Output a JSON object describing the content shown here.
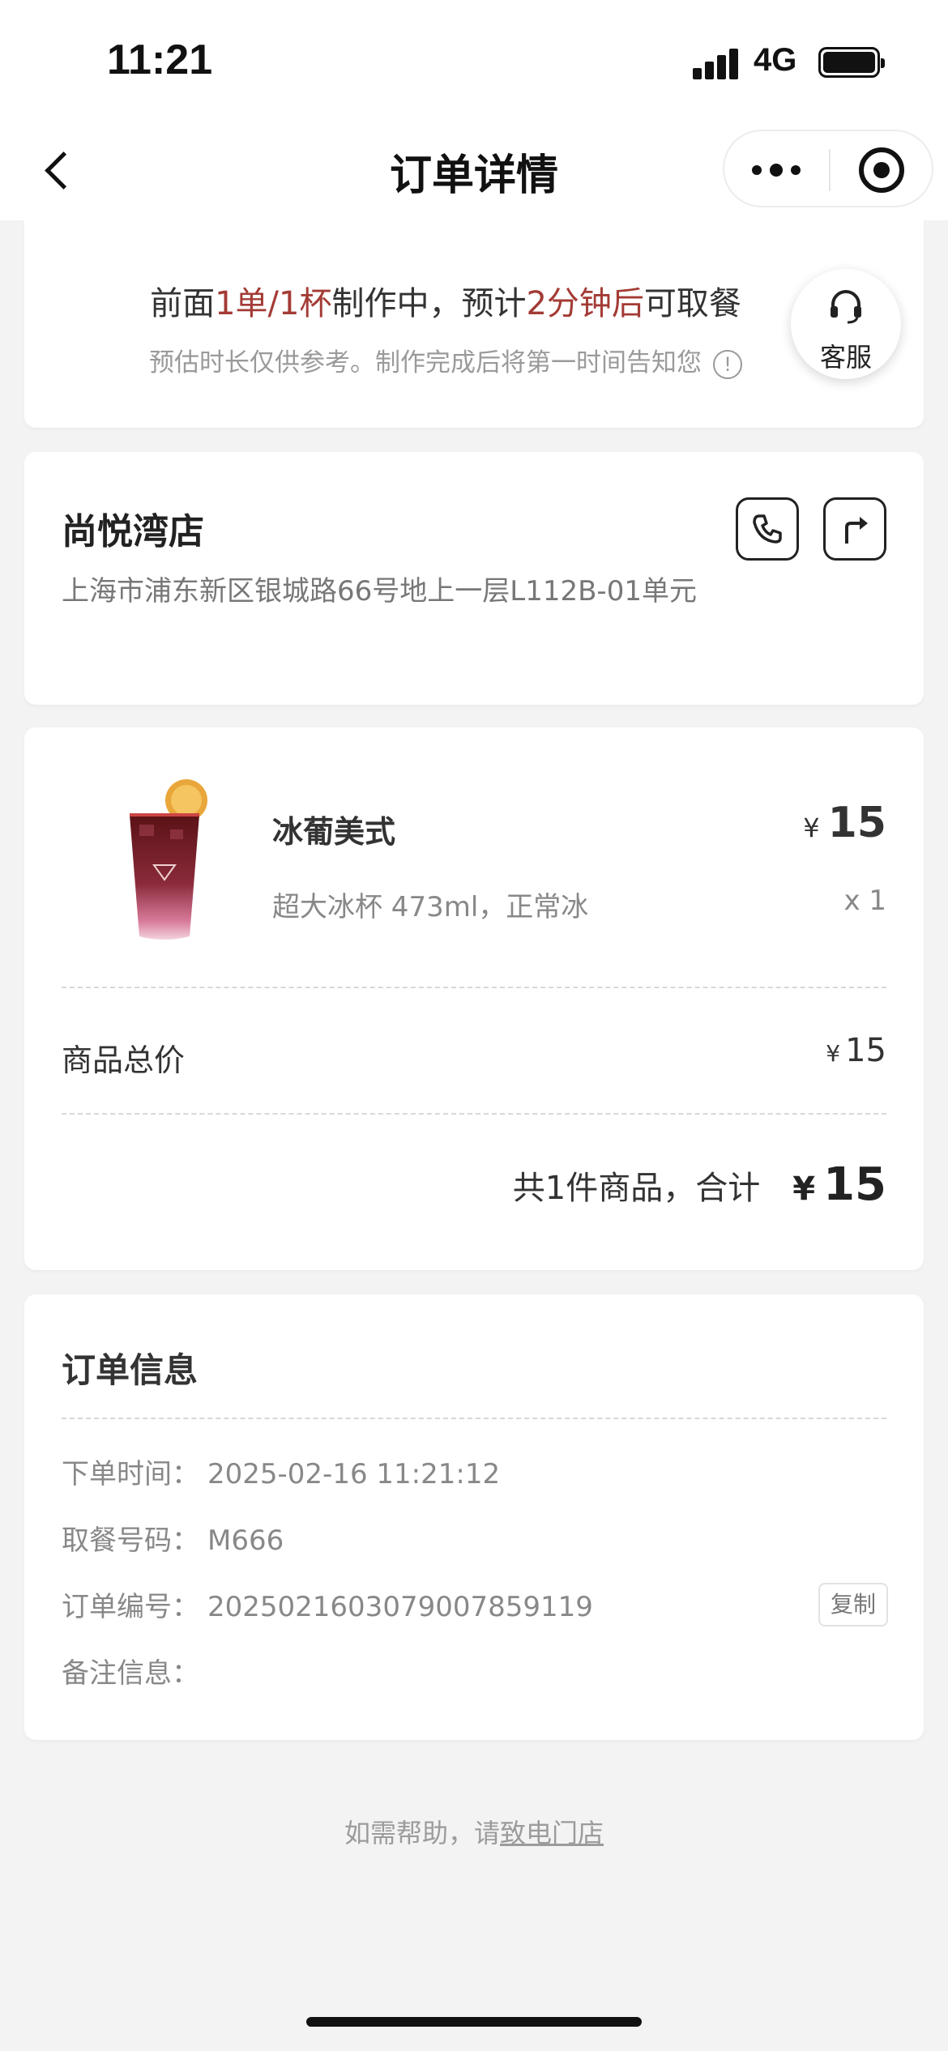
{
  "status_bar": {
    "time": "11:21",
    "network": "4G"
  },
  "nav": {
    "title": "订单详情"
  },
  "progress": {
    "prefix": "前面",
    "queue": "1单/1杯",
    "middle": "制作中，预计",
    "eta": "2分钟后",
    "suffix": "可取餐",
    "note": "预估时长仅供参考。制作完成后将第一时间告知您",
    "info_glyph": "!"
  },
  "service": {
    "label": "客服"
  },
  "store": {
    "name": "尚悦湾店",
    "address": "上海市浦东新区银城路66号地上一层L112B-01单元"
  },
  "product": {
    "name": "冰葡美式",
    "currency": "¥",
    "price": "15",
    "spec": "超大冰杯 473ml，正常冰",
    "qty": "x 1"
  },
  "subtotal": {
    "label": "商品总价",
    "currency": "¥",
    "value": "15"
  },
  "total": {
    "text": "共1件商品，合计",
    "currency": "¥",
    "value": "15"
  },
  "order_info": {
    "title": "订单信息",
    "rows": [
      {
        "label": "下单时间：",
        "value": "2025-02-16 11:21:12"
      },
      {
        "label": "取餐号码：",
        "value": "M666"
      },
      {
        "label": "订单编号：",
        "value": "2025021603079007859119"
      },
      {
        "label": "备注信息：",
        "value": ""
      }
    ],
    "copy_label": "复制"
  },
  "footer": {
    "text": "如需帮助，请",
    "link": "致电门店"
  },
  "colors": {
    "accent": "#a33b35",
    "background": "#f3f3f3"
  }
}
